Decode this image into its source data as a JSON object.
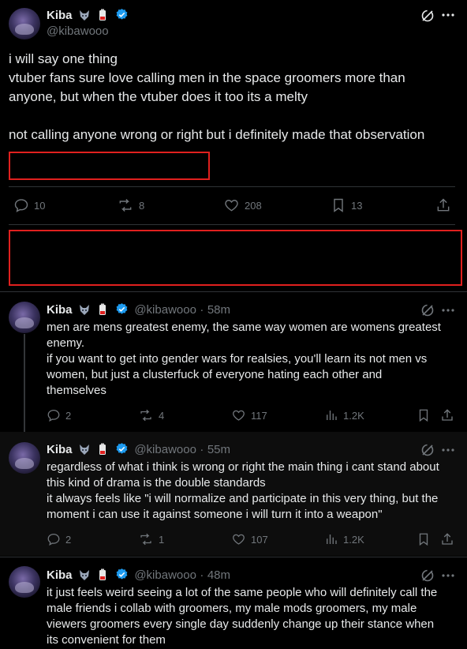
{
  "main_post": {
    "display_name": "Kiba",
    "handle": "@kibawooo",
    "text_lines": [
      "i will say one thing",
      "vtuber fans sure love calling men in the space groomers more than",
      "anyone, but when the vtuber does it too its a melty",
      "",
      "not calling anyone wrong or right but i definitely made that observation"
    ],
    "replies": "10",
    "reposts": "8",
    "likes": "208",
    "bookmarks": "13"
  },
  "replies": [
    {
      "display_name": "Kiba",
      "handle": "@kibawooo",
      "sep": "·",
      "time": "58m",
      "text_lines": [
        "men are mens greatest enemy, the same way women are womens greatest",
        "enemy.",
        "if you want to get into gender wars for realsies, you'll learn its not men vs",
        "women, but just a clusterfuck of everyone hating each other and",
        "themselves"
      ],
      "replies": "2",
      "reposts": "4",
      "likes": "117",
      "views": "1.2K"
    },
    {
      "display_name": "Kiba",
      "handle": "@kibawooo",
      "sep": "·",
      "time": "55m",
      "text_lines": [
        "regardless of what i think is wrong or right the main thing i cant stand about",
        "this kind of drama is the double standards",
        "it always feels like \"i will normalize and participate in this very thing, but the",
        "moment i can use it against someone i will turn it into a weapon\""
      ],
      "replies": "2",
      "reposts": "1",
      "likes": "107",
      "views": "1.2K"
    },
    {
      "display_name": "Kiba",
      "handle": "@kibawooo",
      "sep": "·",
      "time": "48m",
      "text_lines": [
        "it just feels weird seeing a lot of the same people who will definitely call the",
        "male friends i collab with groomers, my male mods groomers, my male",
        "viewers groomers every single day suddenly change up their stance when",
        "its convenient for them"
      ]
    }
  ],
  "colors": {
    "background": "#000000",
    "highlight_bg": "#0d0d0d",
    "text": "#e7e9ea",
    "muted": "#71767b",
    "verified": "#1d9bf0",
    "redaction_box": "#e0201e"
  }
}
